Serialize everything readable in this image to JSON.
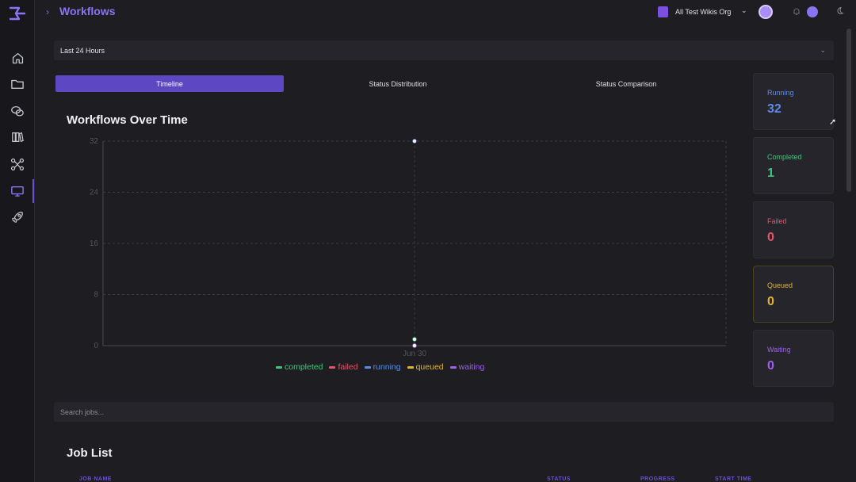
{
  "header": {
    "breadcrumb_chevron": "›",
    "title": "Workflows",
    "org_name": "All Test Wikis Org",
    "org_chevron": "⌄"
  },
  "filters": {
    "time_range": "Last 24 Hours",
    "search_placeholder": "Search jobs..."
  },
  "tabs": [
    {
      "label": "Timeline",
      "active": true
    },
    {
      "label": "Status Distribution",
      "active": false
    },
    {
      "label": "Status Comparison",
      "active": false
    }
  ],
  "chart_data": {
    "type": "line",
    "title": "Workflows Over Time",
    "x": [
      "Jun 30"
    ],
    "ylim": [
      0,
      32
    ],
    "yticks": [
      "0",
      "8",
      "16",
      "24",
      "32"
    ],
    "grid": true,
    "legend_position": "bottom",
    "series": [
      {
        "name": "completed",
        "color": "#3ec97a",
        "values": [
          1
        ]
      },
      {
        "name": "failed",
        "color": "#e0566b",
        "values": [
          0
        ]
      },
      {
        "name": "running",
        "color": "#5b8de8",
        "values": [
          32
        ]
      },
      {
        "name": "queued",
        "color": "#e2b531",
        "values": [
          0
        ]
      },
      {
        "name": "waiting",
        "color": "#9a63e8",
        "values": [
          0
        ]
      }
    ]
  },
  "stats": [
    {
      "label": "Running",
      "value": "32",
      "color": "#5b8de8"
    },
    {
      "label": "Completed",
      "value": "1",
      "color": "#3ec97a"
    },
    {
      "label": "Failed",
      "value": "0",
      "color": "#e0566b"
    },
    {
      "label": "Queued",
      "value": "0",
      "color": "#e2b531"
    },
    {
      "label": "Waiting",
      "value": "0",
      "color": "#9a63e8"
    }
  ],
  "job_list": {
    "title": "Job List",
    "columns": [
      "JOB NAME",
      "STATUS",
      "PROGRESS",
      "START TIME"
    ]
  },
  "icons": {
    "sidebar": [
      "home-icon",
      "folder-icon",
      "chat-icon",
      "library-icon",
      "workflow-icon",
      "monitor-icon",
      "rocket-icon"
    ]
  }
}
